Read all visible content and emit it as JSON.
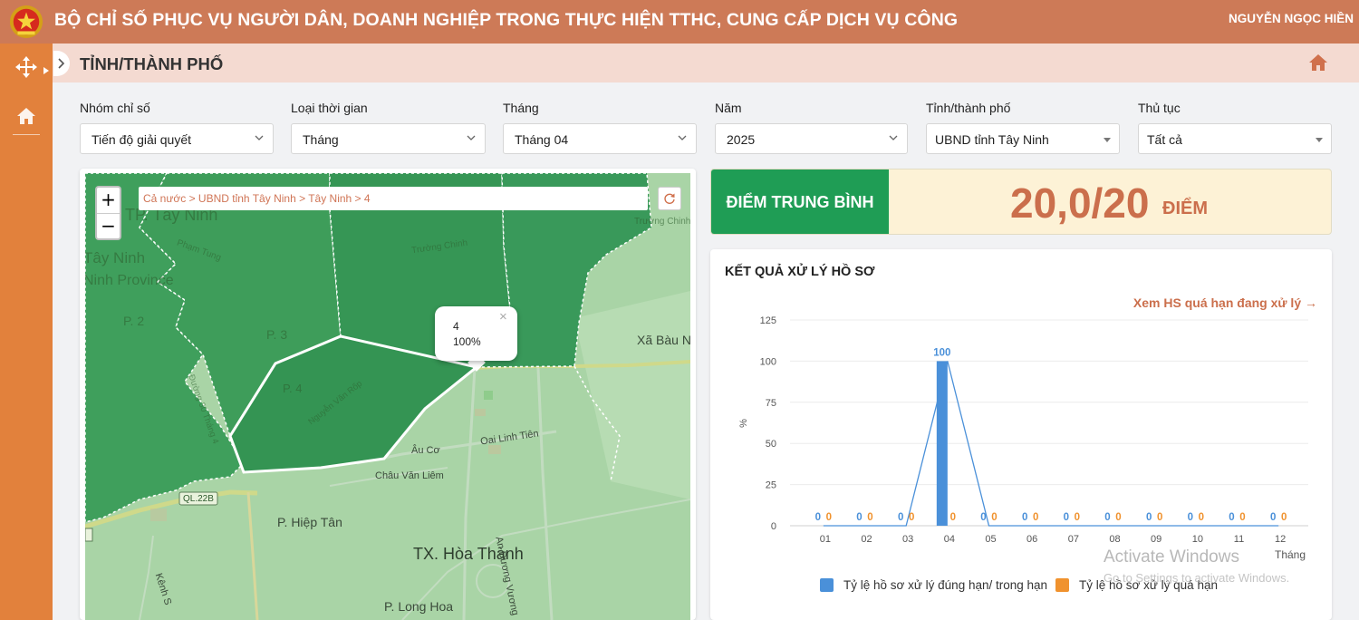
{
  "header": {
    "title": "BỘ CHỈ SỐ PHỤC VỤ NGƯỜI DÂN, DOANH NGHIỆP TRONG THỰC HIỆN TTHC, CUNG CẤP DỊCH VỤ CÔNG",
    "user": "NGUYỄN NGỌC HIỀN"
  },
  "sidebar": {
    "items": [
      {
        "icon": "move-arrows-icon"
      },
      {
        "icon": "home-icon"
      }
    ]
  },
  "page": {
    "title": "TỈNH/THÀNH PHỐ"
  },
  "filters": {
    "group": {
      "label": "Nhóm chỉ số",
      "value": "Tiến độ giải quyết"
    },
    "time_type": {
      "label": "Loại thời gian",
      "value": "Tháng"
    },
    "month": {
      "label": "Tháng",
      "value": "Tháng 04"
    },
    "year": {
      "label": "Năm",
      "value": "2025"
    },
    "province": {
      "label": "Tỉnh/thành phố",
      "value": "UBND tỉnh Tây Ninh"
    },
    "procedure": {
      "label": "Thủ tục",
      "value": "Tất cả"
    }
  },
  "map": {
    "breadcrumb": "Cả nước > UBND tỉnh Tây Ninh > Tây Ninh > 4",
    "zoom_in": "+",
    "zoom_out": "−",
    "popup": {
      "line1": "4",
      "line2": "100%",
      "close": "×"
    },
    "labels": {
      "tp_tay_ninh": "TP. Tây Ninh",
      "tay_ninh": "Tây Ninh",
      "ninh_province": "Ninh Province",
      "p2": "P. 2",
      "p3": "P. 3",
      "p4": "P. 4",
      "pham_tung": "Phạm Tung",
      "truong_chinh": "Trường Chinh",
      "truong_chinh2": "Trường Chinh",
      "xa_bau_n": "Xã Bàu N",
      "au_co": "Âu Cơ",
      "oai_linh_tien": "Oai Linh Tiên",
      "chau_van_liem": "Châu Văn Liêm",
      "ql22b": "QL.22B",
      "p_hiep_tan": "P. Hiệp Tân",
      "tx_hoa_thanh": "TX. Hòa Thành",
      "p_long_hoa": "P. Long Hoa",
      "an_duong_vuong": "An Dương Vương",
      "kenh": "Kênh S",
      "nguyen_van_roi": "Nguyễn Văn Rốp",
      "duong_30_thang_4": "Đường 30 Tháng 4"
    }
  },
  "score": {
    "label": "ĐIỂM TRUNG BÌNH",
    "value": "20,0/20",
    "unit": "ĐIỂM"
  },
  "results": {
    "title": "KẾT QUẢ XỬ LÝ HỒ SƠ",
    "link": "Xem HS quá hạn đang xử lý →"
  },
  "chart_data": {
    "type": "bar",
    "categories": [
      "01",
      "02",
      "03",
      "04",
      "05",
      "06",
      "07",
      "08",
      "09",
      "10",
      "11",
      "12"
    ],
    "series": [
      {
        "name": "Tỷ lệ hồ sơ xử lý đúng hạn/ trong hạn",
        "values": [
          0,
          0,
          0,
          100,
          0,
          0,
          0,
          0,
          0,
          0,
          0,
          0
        ],
        "color": "#4a90d9"
      },
      {
        "name": "Tỷ lệ hồ sơ xử lý quá hạn",
        "values": [
          0,
          0,
          0,
          0,
          0,
          0,
          0,
          0,
          0,
          0,
          0,
          0
        ],
        "color": "#f0922e"
      }
    ],
    "ylabel": "%",
    "xlabel": "Tháng",
    "ylim": [
      0,
      125
    ],
    "yticks": [
      0,
      25,
      50,
      75,
      100,
      125
    ],
    "grid": true,
    "legend": "bottom"
  },
  "watermark": {
    "line1": "Activate Windows",
    "line2": "Go to Settings to activate Windows."
  }
}
